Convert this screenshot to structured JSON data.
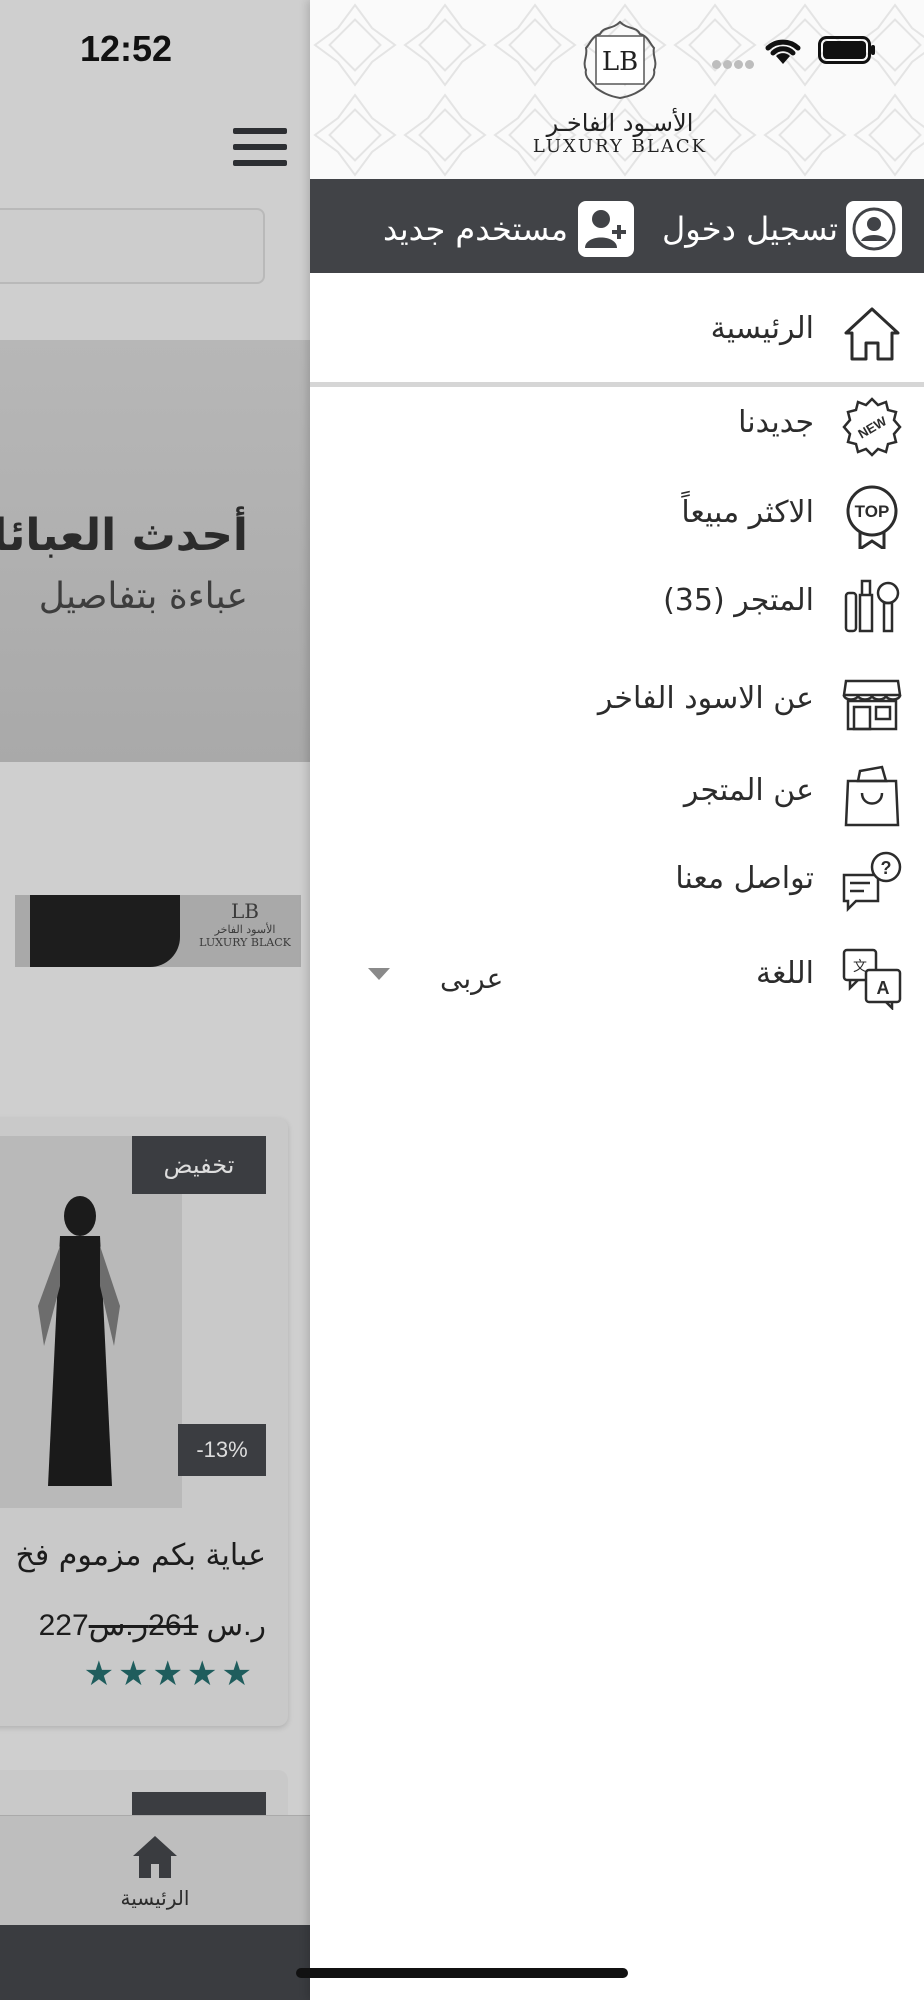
{
  "status_bar": {
    "time": "12:52"
  },
  "background_app": {
    "hero": {
      "title": "أحدث العبائات",
      "subtitle": "عباءة بتفاصيل"
    },
    "banner": {
      "logo_arabic": "الأسود الفاخر",
      "logo_latin": "LUXURY BLACK",
      "logo_mono": "LB"
    },
    "product_card": {
      "discount_tag": "تخفيض",
      "discount_percent": "-13%",
      "title": "عباية بكم مزموم فخ",
      "old_price": "261ر.س",
      "price": "227ر.س",
      "rating": 5,
      "stars": "★★★★★"
    },
    "tabbar": {
      "home_label": "الرئيسية"
    }
  },
  "drawer": {
    "brand": {
      "mono": "LB",
      "arabic": "الأسـود الفاخـر",
      "latin": "LUXURY BLACK"
    },
    "auth": {
      "login_label": "تسجيل دخول",
      "signup_label": "مستخدم جديد"
    },
    "menu": [
      {
        "label": "الرئيسية",
        "icon": "home-icon"
      },
      {
        "label": "جديدنا",
        "icon": "new-badge-icon"
      },
      {
        "label": "الاكثر مبيعاً",
        "icon": "top-award-icon"
      },
      {
        "label": "المتجر (35)",
        "icon": "cosmetics-icon"
      },
      {
        "label": "عن الاسود الفاخر",
        "icon": "storefront-icon"
      },
      {
        "label": "عن المتجر",
        "icon": "shopping-bag-icon"
      },
      {
        "label": "تواصل معنا",
        "icon": "chat-question-icon"
      },
      {
        "label": "اللغة",
        "icon": "translate-icon"
      }
    ],
    "language": {
      "selected": "عربى"
    }
  },
  "colors": {
    "dark_bar": "#414347",
    "accent_stars": "#1f5d5d"
  }
}
